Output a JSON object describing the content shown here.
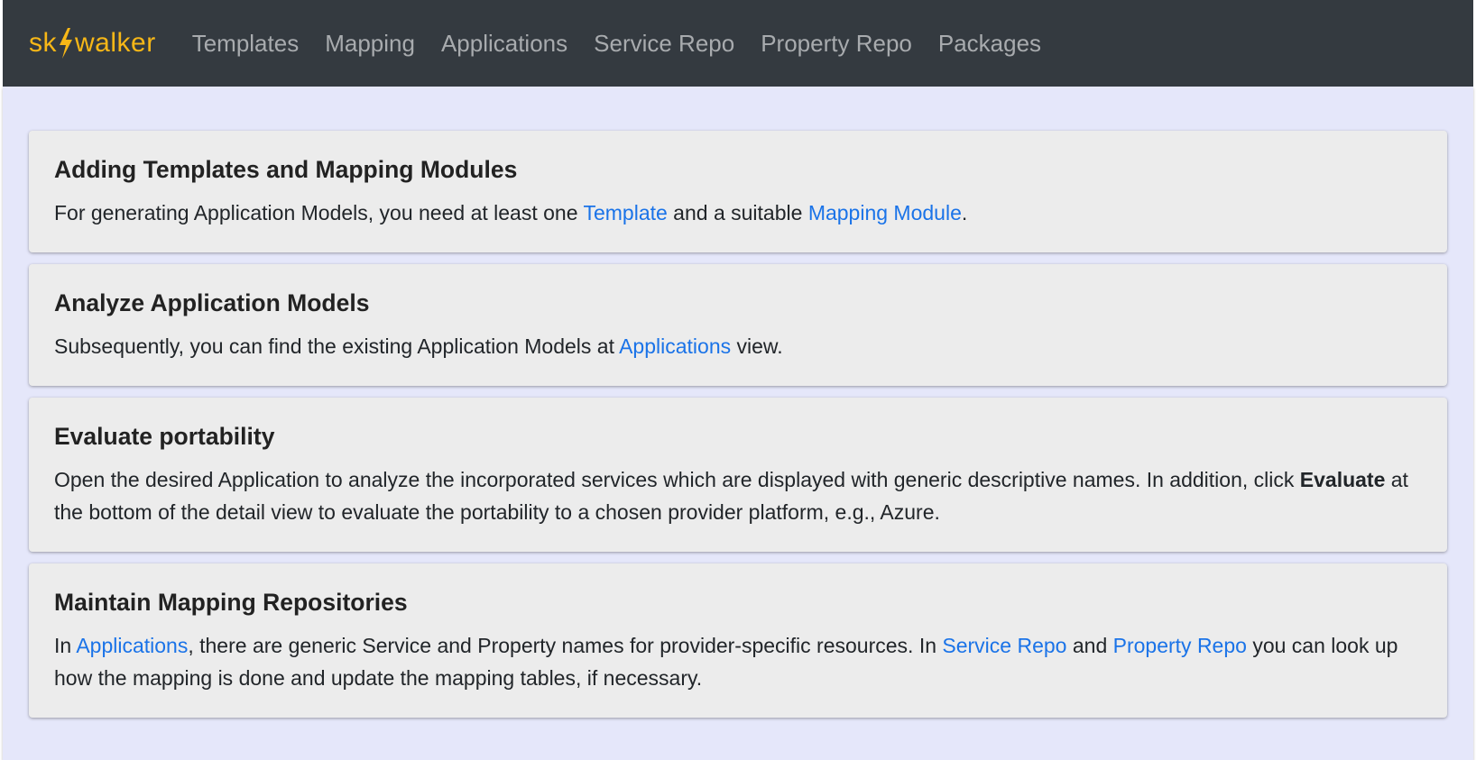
{
  "brand": {
    "left": "sk",
    "right": "walker"
  },
  "nav": [
    {
      "label": "Templates"
    },
    {
      "label": "Mapping"
    },
    {
      "label": "Applications"
    },
    {
      "label": "Service Repo"
    },
    {
      "label": "Property Repo"
    },
    {
      "label": "Packages"
    }
  ],
  "cards": [
    {
      "title": "Adding Templates and Mapping Modules",
      "t1": "For generating Application Models, you need at least one ",
      "link1": "Template",
      "t2": " and a suitable ",
      "link2": "Mapping Module",
      "t3": "."
    },
    {
      "title": "Analyze Application Models",
      "t1": "Subsequently, you can find the existing Application Models at ",
      "link1": "Applications",
      "t2": " view."
    },
    {
      "title": "Evaluate portability",
      "t1": "Open the desired Application to analyze the incorporated services which are displayed with generic descriptive names. In addition, click ",
      "bold1": "Evaluate",
      "t2": " at the bottom of the detail view to evaluate the portability to a chosen provider platform, e.g., Azure."
    },
    {
      "title": "Maintain Mapping Repositories",
      "t1": "In ",
      "link1": "Applications",
      "t2": ", there are generic Service and Property names for provider-specific resources. In ",
      "link2": "Service Repo",
      "t3": " and ",
      "link3": "Property Repo",
      "t4": " you can look up how the mapping is done and update the mapping tables, if necessary."
    }
  ],
  "colors": {
    "navbar": "#343a40",
    "brand": "#f7b717",
    "background": "#e5e7fa",
    "card": "#ececec",
    "link": "#1a73e8"
  }
}
